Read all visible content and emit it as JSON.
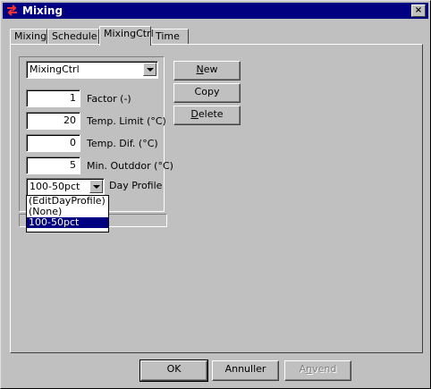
{
  "window": {
    "title": "Mixing",
    "close_label": "×"
  },
  "tabs": [
    {
      "label": "Mixing"
    },
    {
      "label": "Schedule"
    },
    {
      "label": "MixingCtrl"
    },
    {
      "label": "Time"
    }
  ],
  "active_tab": "MixingCtrl",
  "controller_select": {
    "value": "MixingCtrl"
  },
  "fields": [
    {
      "value": "1",
      "label": "Factor (-)"
    },
    {
      "value": "20",
      "label": "Temp. Limit (°C)"
    },
    {
      "value": "0",
      "label": "Temp. Dif. (°C)"
    },
    {
      "value": "5",
      "label": "Min. Outddor (°C)"
    }
  ],
  "day_profile": {
    "value": "100-50pct",
    "label": "Day Profile",
    "options": [
      "(EditDayProfile)",
      "(None)",
      "100-50pct"
    ],
    "selected_index": 2
  },
  "side_buttons": {
    "new_first": "N",
    "new_rest": "ew",
    "copy": "Copy",
    "delete_first": "D",
    "delete_rest": "elete"
  },
  "footer": {
    "ok": "OK",
    "annuller": "Annuller",
    "anvend_first": "A",
    "anvend_u": "n",
    "anvend_rest": "vend"
  },
  "colors": {
    "title_bar": "#000080",
    "face": "#c0c0c0",
    "selection": "#000080"
  },
  "icons": {
    "app": "swap-arrows-icon",
    "dropdown": "chevron-down-icon"
  }
}
